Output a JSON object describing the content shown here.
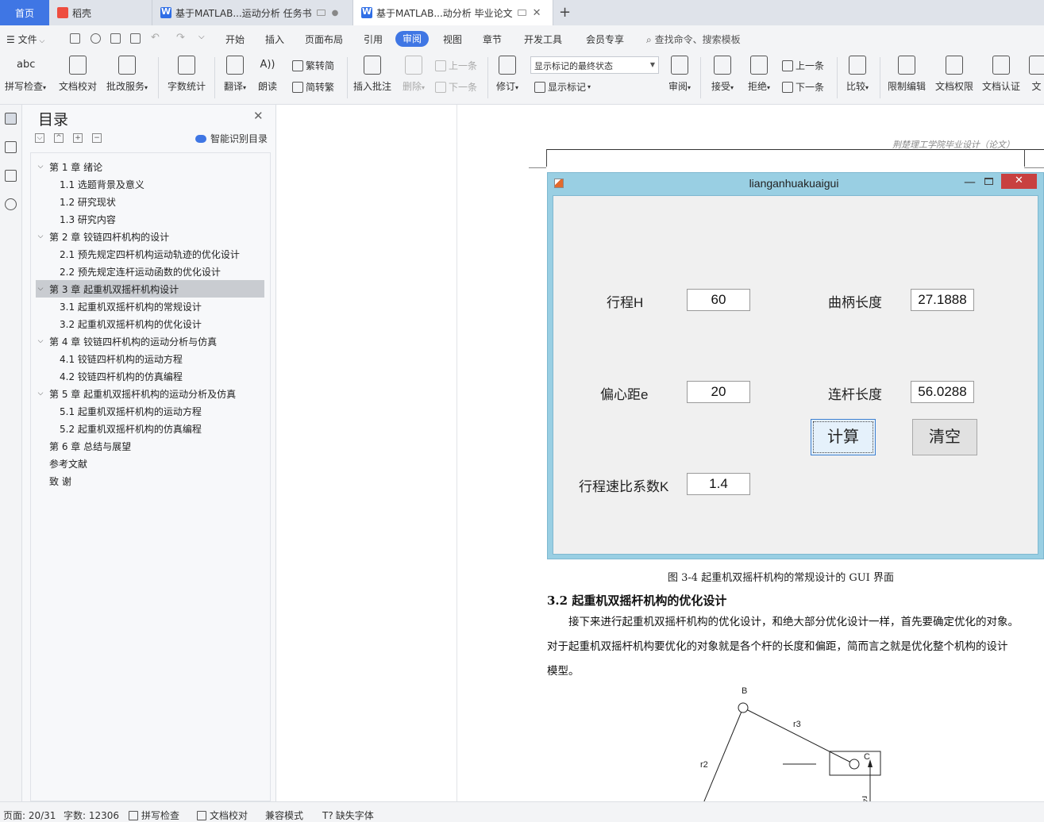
{
  "tabs": {
    "home": "首页",
    "daoke": "稻壳",
    "doc1": "基于MATLAB...运动分析 任务书",
    "doc2": "基于MATLAB...动分析 毕业论文",
    "doc2_close": "✕",
    "new_tab": "+"
  },
  "menu": {
    "file": "文件",
    "items": [
      "开始",
      "插入",
      "页面布局",
      "引用",
      "审阅",
      "视图",
      "章节",
      "开发工具",
      "会员专享"
    ],
    "active": "审阅",
    "search": "查找命令、搜索模板"
  },
  "ribbon": {
    "spell": "拼写检查",
    "proof": "文档校对",
    "annotate_service": "批改服务",
    "wordcount": "字数统计",
    "translate": "翻译",
    "read": "朗读",
    "trad_to_simp": "繁转简",
    "simp_to_trad": "简转繁",
    "insert_comment": "插入批注",
    "delete": "删除",
    "prev_comment": "上一条",
    "next_comment": "下一条",
    "revise": "修订",
    "state_select": "显示标记的最终状态",
    "show_marks": "显示标记",
    "review": "审阅",
    "accept": "接受",
    "reject": "拒绝",
    "prev_change": "上一条",
    "next_change": "下一条",
    "compare": "比较",
    "restrict_edit": "限制编辑",
    "doc_permission": "文档权限",
    "doc_auth": "文档认证",
    "more": "文"
  },
  "toc": {
    "title": "目录",
    "smart": "智能识别目录",
    "items": [
      {
        "text": "第 1 章  绪论",
        "level": 1,
        "chev": "⌵"
      },
      {
        "text": "1.1  选题背景及意义",
        "level": 2
      },
      {
        "text": "1.2  研究现状",
        "level": 2
      },
      {
        "text": "1.3  研究内容",
        "level": 2
      },
      {
        "text": "第 2 章  铰链四杆机构的设计",
        "level": 1,
        "chev": "⌵"
      },
      {
        "text": "2.1  预先规定四杆机构运动轨迹的优化设计",
        "level": 2
      },
      {
        "text": "2.2  预先规定连杆运动函数的优化设计",
        "level": 2
      },
      {
        "text": "第 3 章  起重机双摇杆机构设计",
        "level": 1,
        "chev": "⌵",
        "selected": true
      },
      {
        "text": "3.1  起重机双摇杆机构的常规设计",
        "level": 2
      },
      {
        "text": "3.2  起重机双摇杆机构的优化设计",
        "level": 2
      },
      {
        "text": "第 4 章  铰链四杆机构的运动分析与仿真",
        "level": 1,
        "chev": "⌵"
      },
      {
        "text": "4.1  铰链四杆机构的运动方程",
        "level": 2
      },
      {
        "text": "4.2 铰链四杆机构的仿真编程",
        "level": 2
      },
      {
        "text": "第 5 章  起重机双摇杆机构的运动分析及仿真",
        "level": 1,
        "chev": "⌵"
      },
      {
        "text": "5.1  起重机双摇杆机构的运动方程",
        "level": 2
      },
      {
        "text": "5.2 起重机双摇杆机构的仿真编程",
        "level": 2
      },
      {
        "text": "第 6 章  总结与展望",
        "level": 1
      },
      {
        "text": "参考文献",
        "level": 1
      },
      {
        "text": "致    谢",
        "level": 1
      }
    ]
  },
  "document": {
    "header": "荆楚理工学院毕业设计（论文）",
    "gui": {
      "title": "lianganhuakuaigui",
      "stroke_label": "行程H",
      "stroke_value": "60",
      "offset_label": "偏心距e",
      "offset_value": "20",
      "ratio_label": "行程速比系数K",
      "ratio_value": "1.4",
      "crank_label": "曲柄长度",
      "crank_value": "27.1888",
      "link_label": "连杆长度",
      "link_value": "56.0288",
      "calc_button": "计算",
      "clear_button": "清空",
      "close_glyph": "✕",
      "min_glyph": "—"
    },
    "caption": "图 3-4  起重机双摇杆机构的常规设计的 GUI 界面",
    "section": "3.2  起重机双摇杆机构的优化设计",
    "para_line1": "接下来进行起重机双摇杆机构的优化设计，和绝大部分优化设计一样，首先要确定优化的对象。",
    "para_line2": "对于起重机双摇杆机构要优化的对象就是各个杆的长度和偏距，简而言之就是优化整个机构的设计",
    "para_line3": "模型。",
    "diagram": {
      "label_b": "B",
      "label_r3": "r3",
      "label_r2": "r2",
      "label_c": "C",
      "label_r4": "r4"
    }
  },
  "status": {
    "page": "页面: 20/31",
    "words": "字数: 12306",
    "spell": "拼写检查",
    "proof": "文档校对",
    "compat": "兼容模式",
    "missing_font": "缺失字体"
  }
}
